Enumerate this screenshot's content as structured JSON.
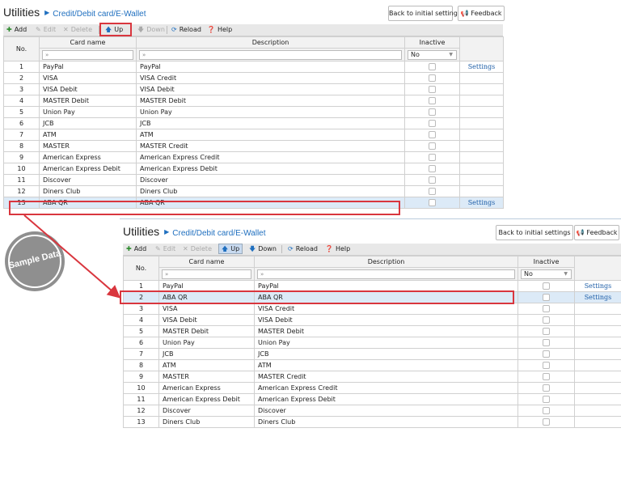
{
  "breadcrumb": {
    "root": "Utilities",
    "separator": "▶",
    "current": "Credit/Debit card/E-Wallet"
  },
  "header_buttons": {
    "back": "Back to initial settings",
    "feedback": "Feedback"
  },
  "toolbar": {
    "add": "Add",
    "edit": "Edit",
    "delete": "Delete",
    "up": "Up",
    "down": "Down",
    "reload": "Reload",
    "help": "Help"
  },
  "columns": {
    "no": "No.",
    "card_name": "Card name",
    "description": "Description",
    "inactive": "Inactive"
  },
  "filters": {
    "card_name_placeholder": "»",
    "description_placeholder": "»",
    "inactive_value": "No"
  },
  "settings_label": "Settings",
  "watermark": "Sample Data",
  "before": {
    "rows": [
      {
        "no": "1",
        "name": "PayPal",
        "desc": "PayPal",
        "settings": "Settings"
      },
      {
        "no": "2",
        "name": "VISA",
        "desc": "VISA Credit",
        "settings": ""
      },
      {
        "no": "3",
        "name": "VISA Debit",
        "desc": "VISA Debit",
        "settings": ""
      },
      {
        "no": "4",
        "name": "MASTER Debit",
        "desc": "MASTER Debit",
        "settings": ""
      },
      {
        "no": "5",
        "name": "Union Pay",
        "desc": "Union Pay",
        "settings": ""
      },
      {
        "no": "6",
        "name": "JCB",
        "desc": "JCB",
        "settings": ""
      },
      {
        "no": "7",
        "name": "ATM",
        "desc": "ATM",
        "settings": ""
      },
      {
        "no": "8",
        "name": "MASTER",
        "desc": "MASTER Credit",
        "settings": ""
      },
      {
        "no": "9",
        "name": "American Express",
        "desc": "American Express Credit",
        "settings": ""
      },
      {
        "no": "10",
        "name": "American Express Debit",
        "desc": "American Express Debit",
        "settings": ""
      },
      {
        "no": "11",
        "name": "Discover",
        "desc": "Discover",
        "settings": ""
      },
      {
        "no": "12",
        "name": "Diners Club",
        "desc": "Diners Club",
        "settings": ""
      },
      {
        "no": "13",
        "name": "ABA QR",
        "desc": "ABA QR",
        "settings": "Settings",
        "selected": true
      }
    ]
  },
  "after": {
    "rows": [
      {
        "no": "1",
        "name": "PayPal",
        "desc": "PayPal",
        "settings": "Settings"
      },
      {
        "no": "2",
        "name": "ABA QR",
        "desc": "ABA QR",
        "settings": "Settings",
        "selected": true
      },
      {
        "no": "3",
        "name": "VISA",
        "desc": "VISA Credit",
        "settings": ""
      },
      {
        "no": "4",
        "name": "VISA Debit",
        "desc": "VISA Debit",
        "settings": ""
      },
      {
        "no": "5",
        "name": "MASTER Debit",
        "desc": "MASTER Debit",
        "settings": ""
      },
      {
        "no": "6",
        "name": "Union Pay",
        "desc": "Union Pay",
        "settings": ""
      },
      {
        "no": "7",
        "name": "JCB",
        "desc": "JCB",
        "settings": ""
      },
      {
        "no": "8",
        "name": "ATM",
        "desc": "ATM",
        "settings": ""
      },
      {
        "no": "9",
        "name": "MASTER",
        "desc": "MASTER Credit",
        "settings": ""
      },
      {
        "no": "10",
        "name": "American Express",
        "desc": "American Express Credit",
        "settings": ""
      },
      {
        "no": "11",
        "name": "American Express Debit",
        "desc": "American Express Debit",
        "settings": ""
      },
      {
        "no": "12",
        "name": "Discover",
        "desc": "Discover",
        "settings": ""
      },
      {
        "no": "13",
        "name": "Diners Club",
        "desc": "Diners Club",
        "settings": ""
      }
    ]
  },
  "colors": {
    "accent": "#1f6fbf",
    "highlight": "#d9363e",
    "selected_row": "#dceaf7"
  }
}
